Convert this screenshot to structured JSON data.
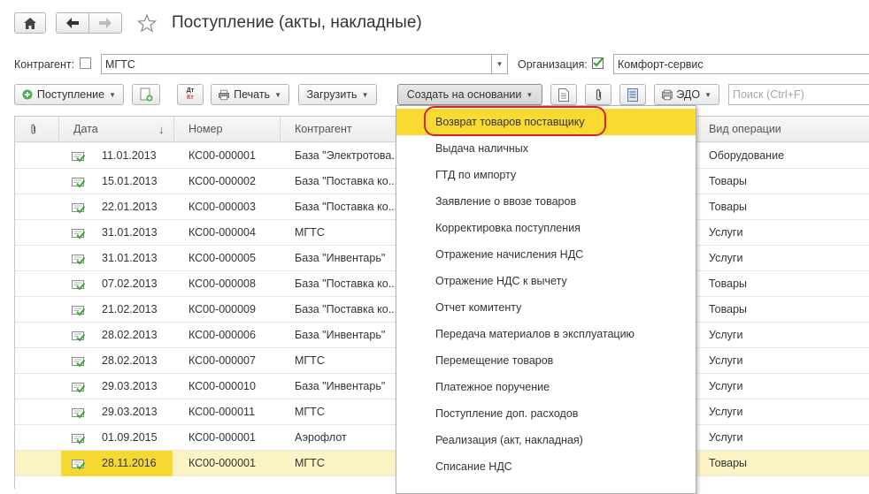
{
  "toolbar_top": {
    "title": "Поступление (акты, накладные)"
  },
  "filters": {
    "contractor_label": "Контрагент:",
    "contractor_value": "МГТС",
    "org_label": "Организация:",
    "org_value": "Комфорт-сервис"
  },
  "commands": {
    "receipt": "Поступление",
    "print": "Печать",
    "load": "Загрузить",
    "create_based": "Создать на основании",
    "edo": "ЭДО",
    "search_placeholder": "Поиск (Ctrl+F)",
    "dtkt_top": "Дт",
    "dtkt_bottom": "Кт"
  },
  "table": {
    "headers": [
      "Дата",
      "Номер",
      "Контрагент",
      "Вид операции"
    ],
    "rows": [
      {
        "date": "11.01.2013",
        "number": "КС00-000001",
        "contractor": "База \"Электротова...",
        "operation": "Оборудование"
      },
      {
        "date": "15.01.2013",
        "number": "КС00-000002",
        "contractor": "База \"Поставка ко...",
        "operation": "Товары"
      },
      {
        "date": "22.01.2013",
        "number": "КС00-000003",
        "contractor": "База \"Поставка ко...",
        "operation": "Товары"
      },
      {
        "date": "31.01.2013",
        "number": "КС00-000004",
        "contractor": "МГТС",
        "operation": "Услуги"
      },
      {
        "date": "31.01.2013",
        "number": "КС00-000005",
        "contractor": "База \"Инвентарь\"",
        "operation": "Услуги"
      },
      {
        "date": "07.02.2013",
        "number": "КС00-000008",
        "contractor": "База \"Поставка ко...",
        "operation": "Товары"
      },
      {
        "date": "21.02.2013",
        "number": "КС00-000009",
        "contractor": "База \"Поставка ко...",
        "operation": "Товары"
      },
      {
        "date": "28.02.2013",
        "number": "КС00-000006",
        "contractor": "База \"Инвентарь\"",
        "operation": "Услуги"
      },
      {
        "date": "28.02.2013",
        "number": "КС00-000007",
        "contractor": "МГТС",
        "operation": "Услуги"
      },
      {
        "date": "29.03.2013",
        "number": "КС00-000010",
        "contractor": "База \"Инвентарь\"",
        "operation": "Услуги"
      },
      {
        "date": "29.03.2013",
        "number": "КС00-000011",
        "contractor": "МГТС",
        "operation": "Услуги"
      },
      {
        "date": "01.09.2015",
        "number": "КС00-000001",
        "contractor": "Аэрофлот",
        "operation": "Услуги"
      },
      {
        "date": "28.11.2016",
        "number": "КС00-000001",
        "contractor": "МГТС",
        "operation": "Товары"
      }
    ]
  },
  "menu": {
    "items": [
      "Возврат товаров поставщику",
      "Выдача наличных",
      "ГТД по импорту",
      "Заявление о ввозе товаров",
      "Корректировка поступления",
      "Отражение начисления НДС",
      "Отражение НДС к вычету",
      "Отчет комитенту",
      "Передача материалов в эксплуатацию",
      "Перемещение товаров",
      "Платежное поручение",
      "Поступление доп. расходов",
      "Реализация (акт, накладная)",
      "Списание НДС"
    ]
  },
  "colors": {
    "highlight": "#f8da31",
    "selected_row": "#fbf3c4",
    "ring": "#d8202a",
    "check_green": "#3aa836"
  }
}
